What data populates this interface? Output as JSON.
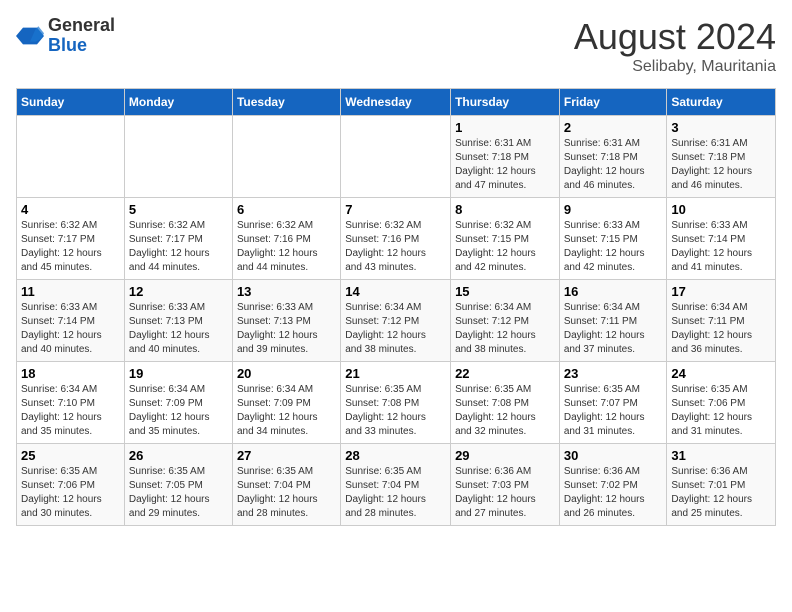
{
  "header": {
    "logo_general": "General",
    "logo_blue": "Blue",
    "month_year": "August 2024",
    "location": "Selibaby, Mauritania"
  },
  "days_of_week": [
    "Sunday",
    "Monday",
    "Tuesday",
    "Wednesday",
    "Thursday",
    "Friday",
    "Saturday"
  ],
  "weeks": [
    [
      {
        "day": "",
        "info": ""
      },
      {
        "day": "",
        "info": ""
      },
      {
        "day": "",
        "info": ""
      },
      {
        "day": "",
        "info": ""
      },
      {
        "day": "1",
        "info": "Sunrise: 6:31 AM\nSunset: 7:18 PM\nDaylight: 12 hours\nand 47 minutes."
      },
      {
        "day": "2",
        "info": "Sunrise: 6:31 AM\nSunset: 7:18 PM\nDaylight: 12 hours\nand 46 minutes."
      },
      {
        "day": "3",
        "info": "Sunrise: 6:31 AM\nSunset: 7:18 PM\nDaylight: 12 hours\nand 46 minutes."
      }
    ],
    [
      {
        "day": "4",
        "info": "Sunrise: 6:32 AM\nSunset: 7:17 PM\nDaylight: 12 hours\nand 45 minutes."
      },
      {
        "day": "5",
        "info": "Sunrise: 6:32 AM\nSunset: 7:17 PM\nDaylight: 12 hours\nand 44 minutes."
      },
      {
        "day": "6",
        "info": "Sunrise: 6:32 AM\nSunset: 7:16 PM\nDaylight: 12 hours\nand 44 minutes."
      },
      {
        "day": "7",
        "info": "Sunrise: 6:32 AM\nSunset: 7:16 PM\nDaylight: 12 hours\nand 43 minutes."
      },
      {
        "day": "8",
        "info": "Sunrise: 6:32 AM\nSunset: 7:15 PM\nDaylight: 12 hours\nand 42 minutes."
      },
      {
        "day": "9",
        "info": "Sunrise: 6:33 AM\nSunset: 7:15 PM\nDaylight: 12 hours\nand 42 minutes."
      },
      {
        "day": "10",
        "info": "Sunrise: 6:33 AM\nSunset: 7:14 PM\nDaylight: 12 hours\nand 41 minutes."
      }
    ],
    [
      {
        "day": "11",
        "info": "Sunrise: 6:33 AM\nSunset: 7:14 PM\nDaylight: 12 hours\nand 40 minutes."
      },
      {
        "day": "12",
        "info": "Sunrise: 6:33 AM\nSunset: 7:13 PM\nDaylight: 12 hours\nand 40 minutes."
      },
      {
        "day": "13",
        "info": "Sunrise: 6:33 AM\nSunset: 7:13 PM\nDaylight: 12 hours\nand 39 minutes."
      },
      {
        "day": "14",
        "info": "Sunrise: 6:34 AM\nSunset: 7:12 PM\nDaylight: 12 hours\nand 38 minutes."
      },
      {
        "day": "15",
        "info": "Sunrise: 6:34 AM\nSunset: 7:12 PM\nDaylight: 12 hours\nand 38 minutes."
      },
      {
        "day": "16",
        "info": "Sunrise: 6:34 AM\nSunset: 7:11 PM\nDaylight: 12 hours\nand 37 minutes."
      },
      {
        "day": "17",
        "info": "Sunrise: 6:34 AM\nSunset: 7:11 PM\nDaylight: 12 hours\nand 36 minutes."
      }
    ],
    [
      {
        "day": "18",
        "info": "Sunrise: 6:34 AM\nSunset: 7:10 PM\nDaylight: 12 hours\nand 35 minutes."
      },
      {
        "day": "19",
        "info": "Sunrise: 6:34 AM\nSunset: 7:09 PM\nDaylight: 12 hours\nand 35 minutes."
      },
      {
        "day": "20",
        "info": "Sunrise: 6:34 AM\nSunset: 7:09 PM\nDaylight: 12 hours\nand 34 minutes."
      },
      {
        "day": "21",
        "info": "Sunrise: 6:35 AM\nSunset: 7:08 PM\nDaylight: 12 hours\nand 33 minutes."
      },
      {
        "day": "22",
        "info": "Sunrise: 6:35 AM\nSunset: 7:08 PM\nDaylight: 12 hours\nand 32 minutes."
      },
      {
        "day": "23",
        "info": "Sunrise: 6:35 AM\nSunset: 7:07 PM\nDaylight: 12 hours\nand 31 minutes."
      },
      {
        "day": "24",
        "info": "Sunrise: 6:35 AM\nSunset: 7:06 PM\nDaylight: 12 hours\nand 31 minutes."
      }
    ],
    [
      {
        "day": "25",
        "info": "Sunrise: 6:35 AM\nSunset: 7:06 PM\nDaylight: 12 hours\nand 30 minutes."
      },
      {
        "day": "26",
        "info": "Sunrise: 6:35 AM\nSunset: 7:05 PM\nDaylight: 12 hours\nand 29 minutes."
      },
      {
        "day": "27",
        "info": "Sunrise: 6:35 AM\nSunset: 7:04 PM\nDaylight: 12 hours\nand 28 minutes."
      },
      {
        "day": "28",
        "info": "Sunrise: 6:35 AM\nSunset: 7:04 PM\nDaylight: 12 hours\nand 28 minutes."
      },
      {
        "day": "29",
        "info": "Sunrise: 6:36 AM\nSunset: 7:03 PM\nDaylight: 12 hours\nand 27 minutes."
      },
      {
        "day": "30",
        "info": "Sunrise: 6:36 AM\nSunset: 7:02 PM\nDaylight: 12 hours\nand 26 minutes."
      },
      {
        "day": "31",
        "info": "Sunrise: 6:36 AM\nSunset: 7:01 PM\nDaylight: 12 hours\nand 25 minutes."
      }
    ]
  ]
}
